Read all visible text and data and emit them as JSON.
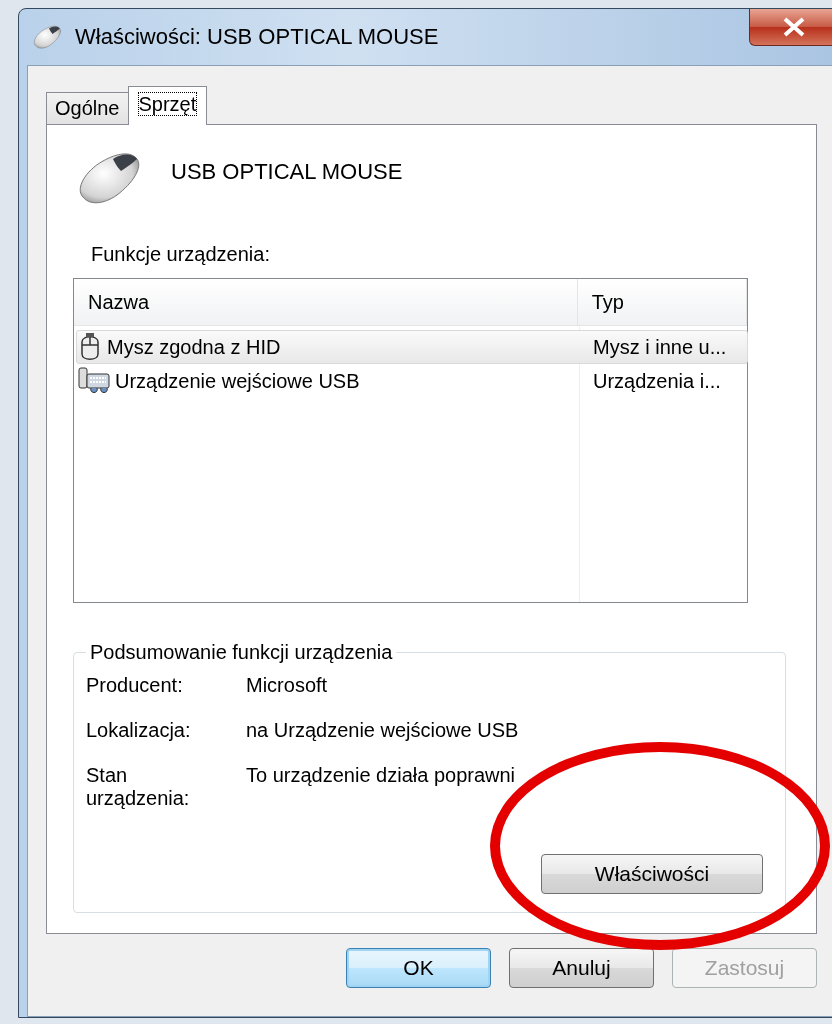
{
  "window": {
    "title": "Właściwości: USB OPTICAL MOUSE"
  },
  "tabs": [
    {
      "label": "Ogólne",
      "selected": false
    },
    {
      "label": "Sprzęt",
      "selected": true
    }
  ],
  "device_name": "USB OPTICAL MOUSE",
  "functions_label": "Funkcje urządzenia:",
  "table": {
    "columns": [
      "Nazwa",
      "Typ"
    ],
    "rows": [
      {
        "name": "Mysz zgodna z HID",
        "type": "Mysz i inne u...",
        "kind": "mouse",
        "selected": true
      },
      {
        "name": "Urządzenie wejściowe USB",
        "type": "Urządzenia i...",
        "kind": "input",
        "selected": false
      }
    ]
  },
  "summary": {
    "title": "Podsumowanie funkcji urządzenia",
    "fields": [
      {
        "label": "Producent:",
        "value": "Microsoft"
      },
      {
        "label": "Lokalizacja:",
        "value": "na Urządzenie wejściowe USB"
      },
      {
        "label": "Stan urządzenia:",
        "value": "To urządzenie działa poprawni"
      }
    ],
    "button": "Właściwości"
  },
  "buttons": [
    {
      "label": "OK",
      "default": true,
      "disabled": false
    },
    {
      "label": "Anuluj",
      "default": false,
      "disabled": false
    },
    {
      "label": "Zastosuj",
      "default": false,
      "disabled": true
    }
  ]
}
